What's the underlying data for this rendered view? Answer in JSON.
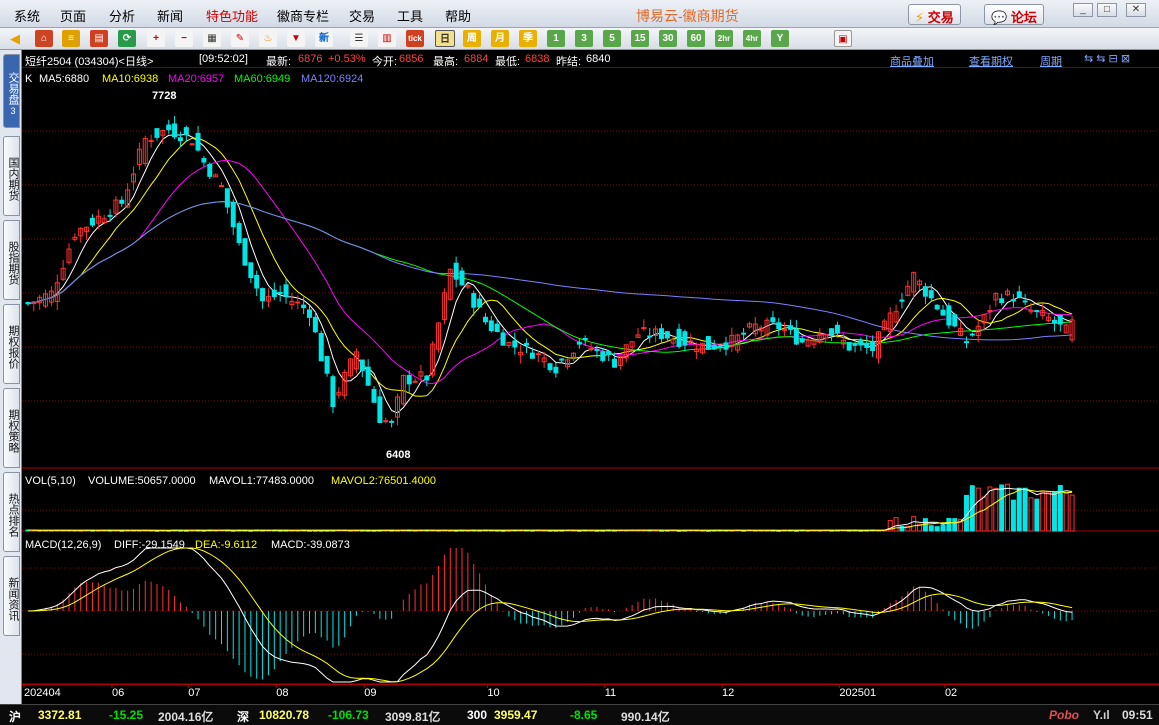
{
  "menu": {
    "items": [
      "系统",
      "页面",
      "分析",
      "新闻",
      "特色功能",
      "徽商专栏",
      "交易",
      "工具",
      "帮助"
    ],
    "app_title": "博易云-徽商期货",
    "trade_label": "交易",
    "forum_label": "论坛"
  },
  "toolbar": {
    "period_buttons": [
      "日",
      "周",
      "月",
      "季",
      "1",
      "3",
      "5",
      "15",
      "30",
      "60",
      "2hr",
      "4hr",
      "Y"
    ],
    "active_period": "日"
  },
  "side_tabs": [
    "交易盘",
    "国内期货",
    "股指期货",
    "期权报价",
    "期权策略",
    "热点排名",
    "新闻资讯"
  ],
  "info": {
    "symbol": "短纤2504 (034304)<日线>",
    "time": "[09:52:02]",
    "latest_label": "最新:",
    "latest": "6876",
    "change": "+0.53%",
    "open_label": "今开:",
    "open": "6856",
    "high_label": "最高:",
    "high": "6884",
    "low_label": "最低:",
    "low": "6838",
    "prev_label": "昨结:",
    "prev": "6840",
    "link1": "商品叠加",
    "link2": "查看期权",
    "link3": "周期"
  },
  "ma_legend": {
    "k": "K",
    "ma5": "MA5:6880",
    "ma10": "MA10:6938",
    "ma20": "MA20:6957",
    "ma60": "MA60:6949",
    "ma120": "MA120:6924"
  },
  "vol_legend": {
    "title": "VOL(5,10)",
    "volume": "VOLUME:50657.0000",
    "mavol1": "MAVOL1:77483.0000",
    "mavol2": "MAVOL2:76501.4000"
  },
  "macd_legend": {
    "title": "MACD(12,26,9)",
    "diff": "DIFF:-29.1549",
    "dea": "DEA:-9.6112",
    "macd": "MACD:-39.0873"
  },
  "annotations": {
    "high": "7728",
    "low": "6408"
  },
  "colors": {
    "up": "#ff3030",
    "down": "#00e5e5",
    "ma5": "#ffffff",
    "ma10": "#ffff00",
    "ma20": "#ff00ff",
    "ma60": "#00ff00",
    "ma120": "#7f7fff",
    "grid": "#8a0000"
  },
  "chart_data": {
    "type": "candlestick",
    "x_labels": [
      "202404",
      "06",
      "07",
      "08",
      "09",
      "10",
      "11",
      "12",
      "202501",
      "02"
    ],
    "price_range": [
      6300,
      7850
    ],
    "close_anchors": [
      [
        0,
        6950
      ],
      [
        4,
        6990
      ],
      [
        8,
        7230
      ],
      [
        12,
        7290
      ],
      [
        16,
        7350
      ],
      [
        20,
        7600
      ],
      [
        24,
        7640
      ],
      [
        28,
        7600
      ],
      [
        30,
        7510
      ],
      [
        33,
        7410
      ],
      [
        36,
        7180
      ],
      [
        40,
        6960
      ],
      [
        43,
        6990
      ],
      [
        48,
        6920
      ],
      [
        52,
        6560
      ],
      [
        56,
        6760
      ],
      [
        60,
        6500
      ],
      [
        62,
        6470
      ],
      [
        64,
        6650
      ],
      [
        68,
        6660
      ],
      [
        72,
        7080
      ],
      [
        75,
        7000
      ],
      [
        78,
        6880
      ],
      [
        82,
        6790
      ],
      [
        86,
        6760
      ],
      [
        90,
        6700
      ],
      [
        94,
        6800
      ],
      [
        97,
        6760
      ],
      [
        100,
        6720
      ],
      [
        104,
        6830
      ],
      [
        108,
        6830
      ],
      [
        112,
        6800
      ],
      [
        116,
        6780
      ],
      [
        120,
        6800
      ],
      [
        124,
        6860
      ],
      [
        128,
        6860
      ],
      [
        132,
        6800
      ],
      [
        136,
        6850
      ],
      [
        140,
        6780
      ],
      [
        144,
        6770
      ],
      [
        148,
        6940
      ],
      [
        151,
        7060
      ],
      [
        154,
        6970
      ],
      [
        157,
        6880
      ],
      [
        160,
        6800
      ],
      [
        163,
        6890
      ],
      [
        165,
        6980
      ],
      [
        168,
        6980
      ],
      [
        171,
        6920
      ],
      [
        174,
        6890
      ],
      [
        177,
        6840
      ],
      [
        178,
        6870
      ]
    ],
    "volume_note": "volume bars appear only from about 202412",
    "legend": {
      "ma": [
        "MA5",
        "MA10",
        "MA20",
        "MA60",
        "MA120"
      ],
      "vol": [
        "VOLUME",
        "MAVOL1",
        "MAVOL2"
      ],
      "macd": [
        "DIFF",
        "DEA",
        "MACD"
      ]
    }
  },
  "status": {
    "sh_label": "沪",
    "sh_index": "3372.81",
    "sh_change": "-15.25",
    "sh_amount": "2004.16亿",
    "sz_label": "深",
    "sz_index": "10820.78",
    "sz_change": "-106.73",
    "sz_amount": "3099.81亿",
    "idx300_label": "300",
    "idx300": "3959.47",
    "idx300_change": "-8.65",
    "idx300_amount": "990.14亿",
    "brand": "Pobo",
    "clock": "09:51"
  }
}
